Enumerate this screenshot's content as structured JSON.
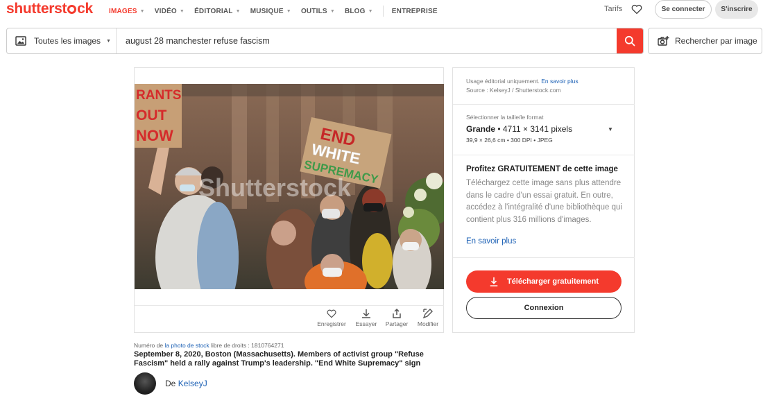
{
  "brand": {
    "name_part1": "shutterst",
    "name_part2": "ck"
  },
  "nav": {
    "items": [
      {
        "label": "IMAGES",
        "active": true
      },
      {
        "label": "VIDÉO"
      },
      {
        "label": "ÉDITORIAL"
      },
      {
        "label": "MUSIQUE"
      },
      {
        "label": "OUTILS"
      },
      {
        "label": "BLOG"
      }
    ],
    "entreprise": "ENTREPRISE",
    "tarifs": "Tarifs",
    "login": "Se connecter",
    "signup": "S'inscrire"
  },
  "search": {
    "filter": "Toutes les images",
    "query": "august 28 manchester refuse fascism",
    "image_search": "Rechercher par image"
  },
  "photo": {
    "sign1": [
      "RANTS",
      "OUT",
      "NOW"
    ],
    "sign2": [
      "END",
      "WHITE",
      "SUPREMACY"
    ],
    "watermark": "Shutterstock"
  },
  "actions": {
    "save": "Enregistrer",
    "rate": "Essayer",
    "share": "Partager",
    "edit": "Modifier"
  },
  "panel": {
    "usage": "Usage éditorial uniquement.",
    "usage_link": "En savoir plus",
    "source": "Source : KelseyJ / Shutterstock.com",
    "size_label": "Sélectionner la taille/le format",
    "size_name": "Grande",
    "size_px": " • 4711 × 3141 pixels",
    "size_detail": "39,9 × 26,6 cm • 300 DPI • JPEG",
    "promo_title": "Profitez GRATUITEMENT de cette image",
    "promo_body": "Téléchargez cette image sans plus attendre dans le cadre d'un essai gratuit. En outre, accédez à l'intégralité d'une bibliothèque qui contient plus 316 millions d'images.",
    "promo_link": "En savoir plus",
    "download": "Télécharger gratuitement",
    "connexion": "Connexion"
  },
  "info": {
    "stock_prefix": "Numéro de ",
    "stock_link": "la photo de stock",
    "stock_suffix": " libre de droits : 1810764271",
    "caption": "September 8, 2020, Boston (Massachusetts). Members of activist group \"Refuse Fascism\" held a rally against Trump's leadership. \"End White Supremacy\" sign",
    "by": "De ",
    "author": "KelseyJ"
  }
}
